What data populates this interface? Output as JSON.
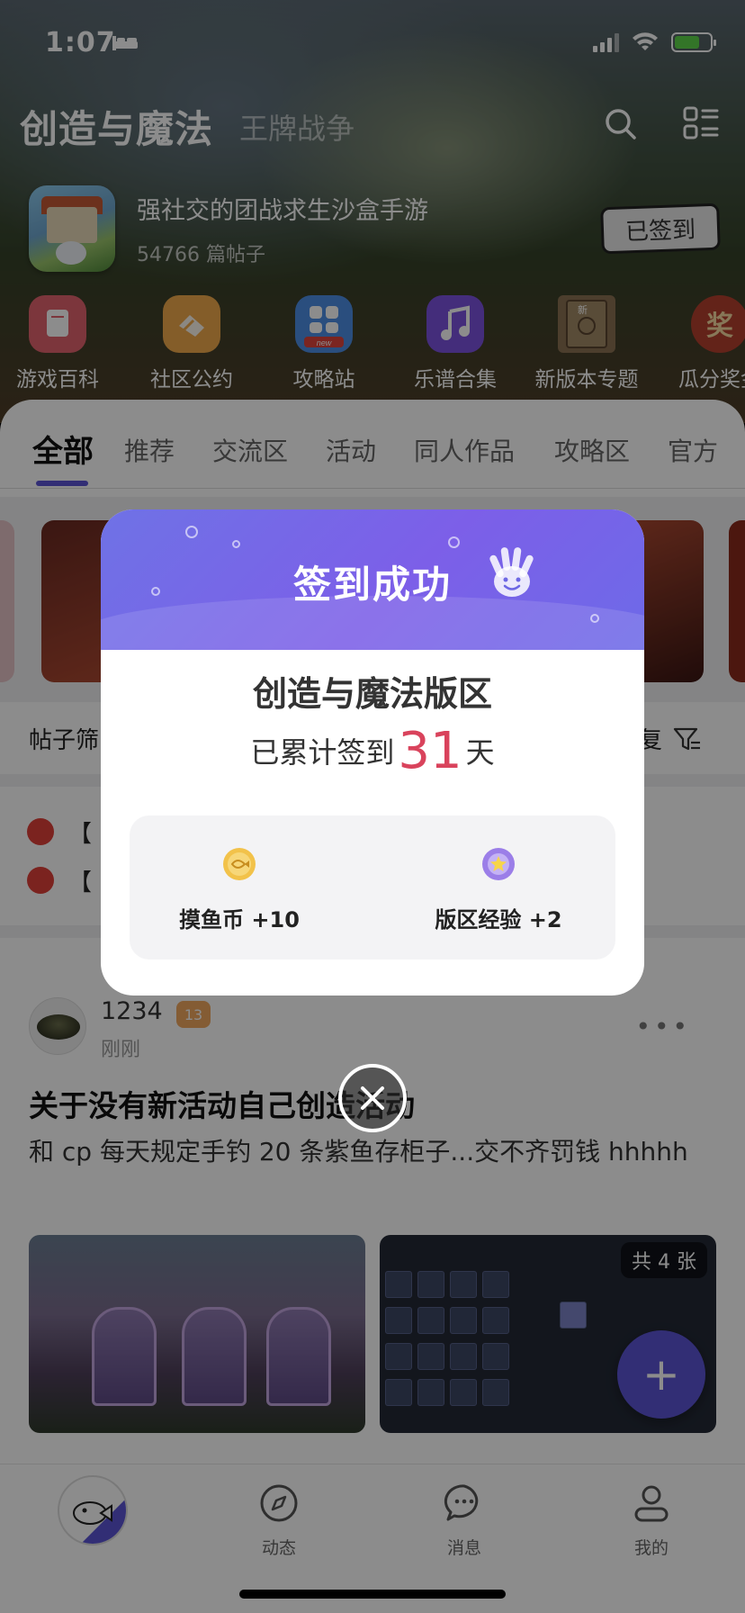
{
  "status_bar": {
    "time": "1:07"
  },
  "header": {
    "title": "创造与魔法",
    "subtitle": "王牌战争",
    "game_tagline": "强社交的团战求生沙盒手游",
    "post_count": "54766 篇帖子",
    "signed_button": "已签到"
  },
  "quick_links": [
    {
      "label": "游戏百科",
      "icon": "encyclopedia-icon",
      "color": "#e2636e"
    },
    {
      "label": "社区公约",
      "icon": "handshake-icon",
      "color": "#f0a94b"
    },
    {
      "label": "攻略站",
      "icon": "guide-apps-icon",
      "color": "#4d8fe5"
    },
    {
      "label": "乐谱合集",
      "icon": "music-note-icon",
      "color": "#7c52e0"
    },
    {
      "label": "新版本专题",
      "icon": "new-version-book-icon",
      "color": "#8a7153"
    },
    {
      "label": "瓜分奖金",
      "icon": "prize-icon",
      "color": "#b4402f"
    }
  ],
  "tabs": [
    "全部",
    "推荐",
    "交流区",
    "活动",
    "同人作品",
    "攻略区",
    "官方"
  ],
  "filter": {
    "label": "帖子筛",
    "right_label": "复"
  },
  "pinned_posts": [
    {
      "prefix": "【"
    },
    {
      "prefix": "【"
    }
  ],
  "post": {
    "username": "1234",
    "level": "13",
    "time": "刚刚",
    "title": "关于没有新活动自己创造活动",
    "body": "和 cp 每天规定手钓 20 条紫鱼存柜子...交不齐罚钱 hhhhh",
    "image_count": "共 4 张"
  },
  "bottom_nav": [
    {
      "label": "动态",
      "icon": "compass-icon"
    },
    {
      "label": "消息",
      "icon": "message-bubble-icon"
    },
    {
      "label": "我的",
      "icon": "profile-icon"
    }
  ],
  "modal": {
    "title": "签到成功",
    "section": "创造与魔法版区",
    "days_prefix": "已累计签到",
    "days_count": "31",
    "days_suffix": "天",
    "rewards": [
      {
        "label": "摸鱼币 +10",
        "icon": "fish-coin-icon",
        "color": "#f2c24a"
      },
      {
        "label": "版区经验 +2",
        "icon": "star-medal-icon",
        "color": "#9b7ee8"
      }
    ]
  },
  "colors": {
    "accent": "#5b55d6",
    "highlight_number": "#d9435c"
  }
}
